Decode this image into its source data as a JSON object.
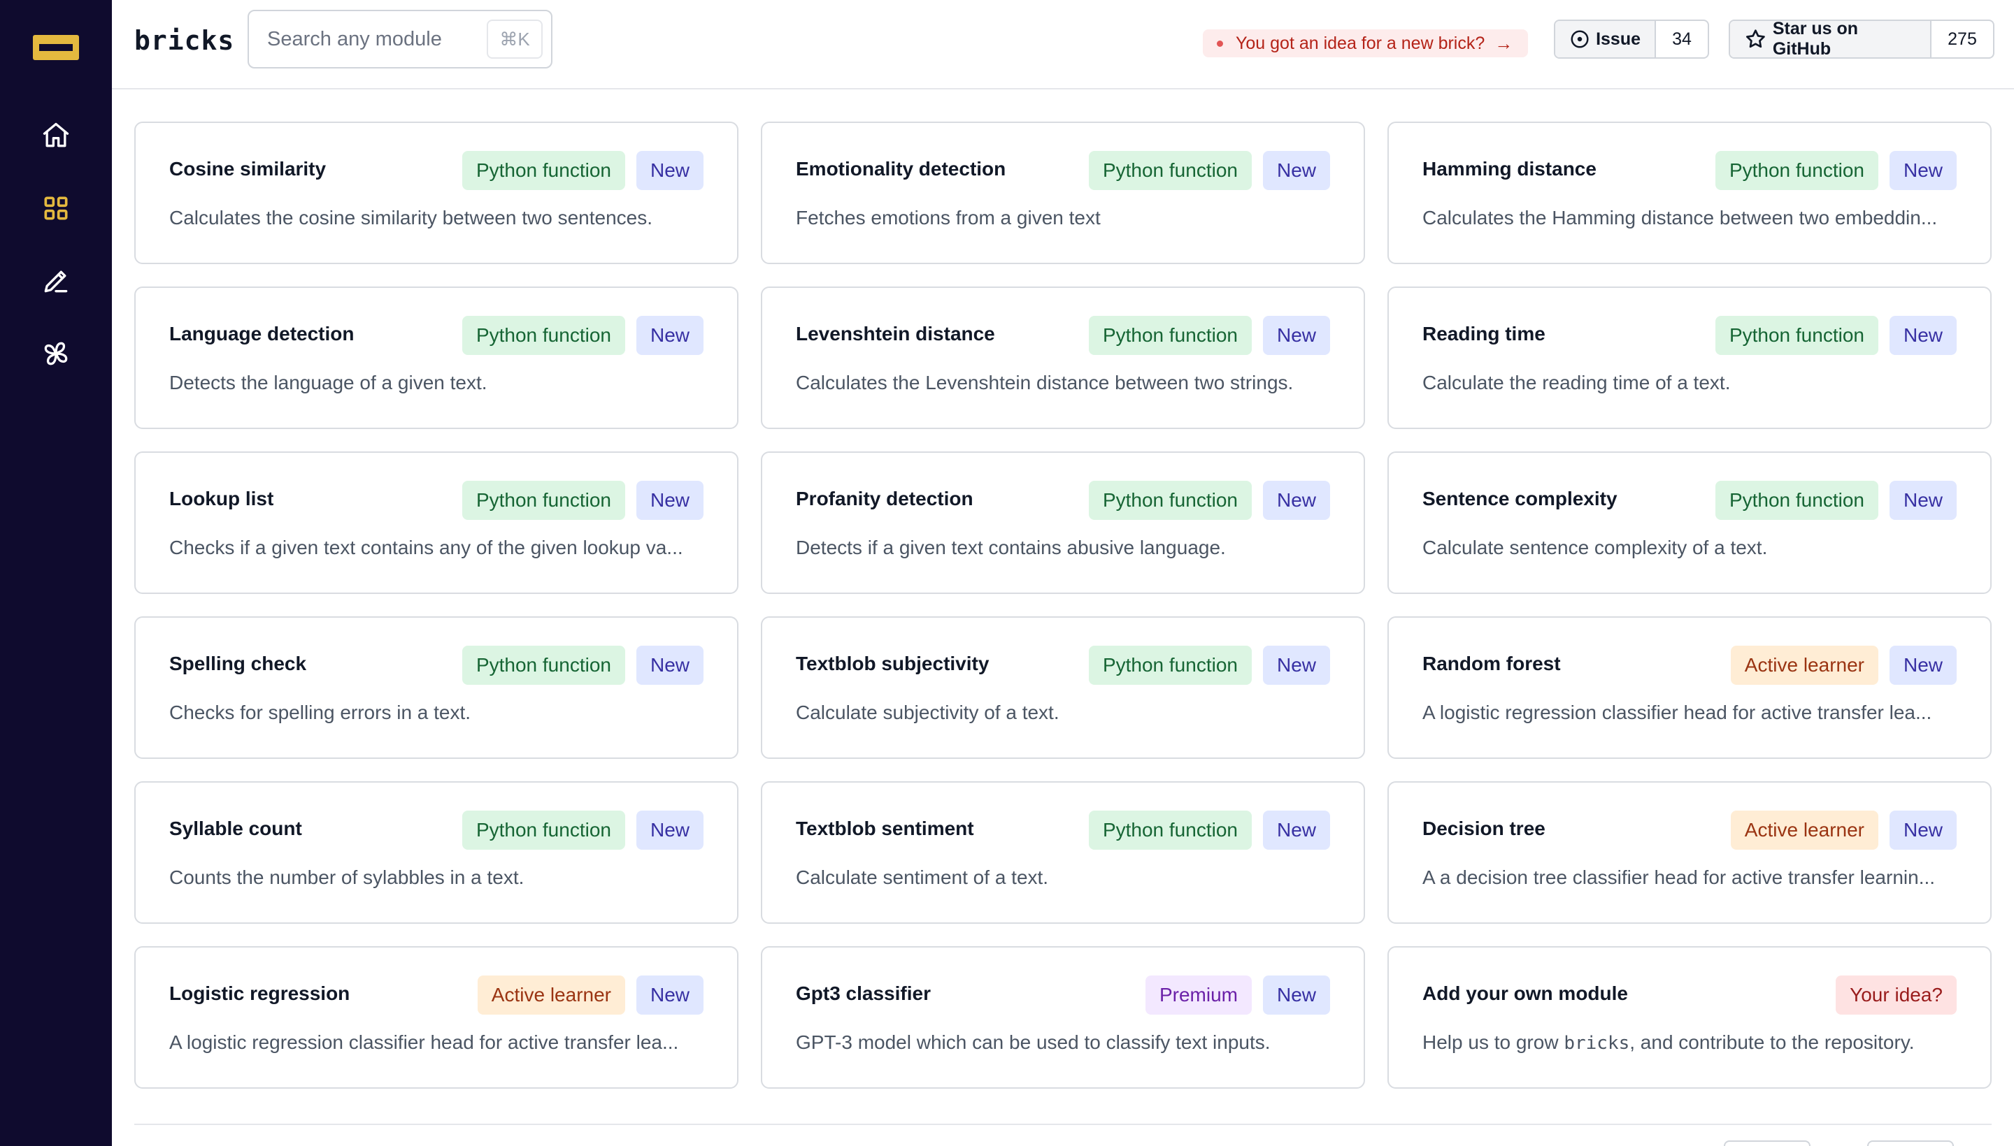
{
  "brand": "bricks",
  "search": {
    "placeholder": "Search any module",
    "shortcut": "⌘K"
  },
  "idea_banner": {
    "label": "You got an idea for a new brick?",
    "arrow": "→"
  },
  "issue": {
    "label": "Issue",
    "count": "34"
  },
  "github": {
    "label": "Star us on GitHub",
    "count": "275"
  },
  "colors": {
    "sidebar_bg": "#0f0b2e",
    "accent": "#e4b93f",
    "python_badge": "#dcf5e3",
    "new_badge": "#e0e7ff",
    "active_learner_badge": "#ffedd5",
    "premium_badge": "#f3e8ff",
    "idea_badge": "#fee2e2"
  },
  "nav": [
    {
      "icon": "home-icon",
      "active": false
    },
    {
      "icon": "modules-grid-icon",
      "active": true
    },
    {
      "icon": "pencil-edit-icon",
      "active": false
    },
    {
      "icon": "pinwheel-icon",
      "active": false
    }
  ],
  "cards": [
    {
      "title": "Cosine similarity",
      "desc": "Calculates the cosine similarity between two sentences.",
      "badges": [
        {
          "label": "Python function",
          "kind": "python"
        },
        {
          "label": "New",
          "kind": "new"
        }
      ]
    },
    {
      "title": "Emotionality detection",
      "desc": "Fetches emotions from a given text",
      "badges": [
        {
          "label": "Python function",
          "kind": "python"
        },
        {
          "label": "New",
          "kind": "new"
        }
      ]
    },
    {
      "title": "Hamming distance",
      "desc": "Calculates the Hamming distance between two embeddin...",
      "badges": [
        {
          "label": "Python function",
          "kind": "python"
        },
        {
          "label": "New",
          "kind": "new"
        }
      ]
    },
    {
      "title": "Language detection",
      "desc": "Detects the language of a given text.",
      "badges": [
        {
          "label": "Python function",
          "kind": "python"
        },
        {
          "label": "New",
          "kind": "new"
        }
      ]
    },
    {
      "title": "Levenshtein distance",
      "desc": "Calculates the Levenshtein distance between two strings.",
      "badges": [
        {
          "label": "Python function",
          "kind": "python"
        },
        {
          "label": "New",
          "kind": "new"
        }
      ]
    },
    {
      "title": "Reading time",
      "desc": "Calculate the reading time of a text.",
      "badges": [
        {
          "label": "Python function",
          "kind": "python"
        },
        {
          "label": "New",
          "kind": "new"
        }
      ]
    },
    {
      "title": "Lookup list",
      "desc": "Checks if a given text contains any of the given lookup va...",
      "badges": [
        {
          "label": "Python function",
          "kind": "python"
        },
        {
          "label": "New",
          "kind": "new"
        }
      ]
    },
    {
      "title": "Profanity detection",
      "desc": "Detects if a given text contains abusive language.",
      "badges": [
        {
          "label": "Python function",
          "kind": "python"
        },
        {
          "label": "New",
          "kind": "new"
        }
      ]
    },
    {
      "title": "Sentence complexity",
      "desc": "Calculate sentence complexity of a text.",
      "badges": [
        {
          "label": "Python function",
          "kind": "python"
        },
        {
          "label": "New",
          "kind": "new"
        }
      ]
    },
    {
      "title": "Spelling check",
      "desc": "Checks for spelling errors in a text.",
      "badges": [
        {
          "label": "Python function",
          "kind": "python"
        },
        {
          "label": "New",
          "kind": "new"
        }
      ]
    },
    {
      "title": "Textblob subjectivity",
      "desc": "Calculate subjectivity of a text.",
      "badges": [
        {
          "label": "Python function",
          "kind": "python"
        },
        {
          "label": "New",
          "kind": "new"
        }
      ]
    },
    {
      "title": "Random forest",
      "desc": "A logistic regression classifier head for active transfer lea...",
      "badges": [
        {
          "label": "Active learner",
          "kind": "active"
        },
        {
          "label": "New",
          "kind": "new"
        }
      ]
    },
    {
      "title": "Syllable count",
      "desc": "Counts the number of sylabbles in a text.",
      "badges": [
        {
          "label": "Python function",
          "kind": "python"
        },
        {
          "label": "New",
          "kind": "new"
        }
      ]
    },
    {
      "title": "Textblob sentiment",
      "desc": "Calculate sentiment of a text.",
      "badges": [
        {
          "label": "Python function",
          "kind": "python"
        },
        {
          "label": "New",
          "kind": "new"
        }
      ]
    },
    {
      "title": "Decision tree",
      "desc": "A a decision tree classifier head for active transfer learnin...",
      "badges": [
        {
          "label": "Active learner",
          "kind": "active"
        },
        {
          "label": "New",
          "kind": "new"
        }
      ]
    },
    {
      "title": "Logistic regression",
      "desc": "A logistic regression classifier head for active transfer lea...",
      "badges": [
        {
          "label": "Active learner",
          "kind": "active"
        },
        {
          "label": "New",
          "kind": "new"
        }
      ]
    },
    {
      "title": "Gpt3 classifier",
      "desc": "GPT-3 model which can be used to classify text inputs.",
      "badges": [
        {
          "label": "Premium",
          "kind": "premium"
        },
        {
          "label": "New",
          "kind": "new"
        }
      ]
    },
    {
      "title": "Add your own module",
      "desc_pre": "Help us to grow ",
      "desc_code": "bricks",
      "desc_post": ", and contribute to the repository.",
      "badges": [
        {
          "label": "Your idea?",
          "kind": "idea"
        }
      ]
    }
  ]
}
